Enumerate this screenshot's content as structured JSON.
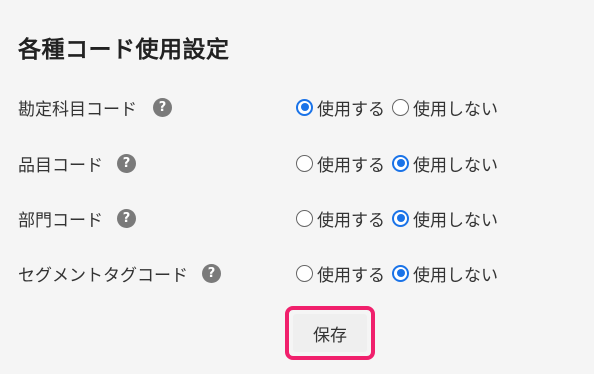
{
  "page": {
    "title": "各種コード使用設定"
  },
  "settings": [
    {
      "label": "勘定科目コード",
      "help_icon": "?",
      "options": [
        {
          "label": "使用する",
          "checked": true
        },
        {
          "label": "使用しない",
          "checked": false
        }
      ]
    },
    {
      "label": "品目コード",
      "help_icon": "?",
      "options": [
        {
          "label": "使用する",
          "checked": false
        },
        {
          "label": "使用しない",
          "checked": true
        }
      ]
    },
    {
      "label": "部門コード",
      "help_icon": "?",
      "options": [
        {
          "label": "使用する",
          "checked": false
        },
        {
          "label": "使用しない",
          "checked": true
        }
      ]
    },
    {
      "label": "セグメントタグコード",
      "help_icon": "?",
      "options": [
        {
          "label": "使用する",
          "checked": false
        },
        {
          "label": "使用しない",
          "checked": true
        }
      ]
    }
  ],
  "actions": {
    "save_label": "保存"
  },
  "colors": {
    "highlight": "#f0206c",
    "radio_selected": "#1a73e8",
    "help_icon_bg": "#7a7a7a"
  }
}
